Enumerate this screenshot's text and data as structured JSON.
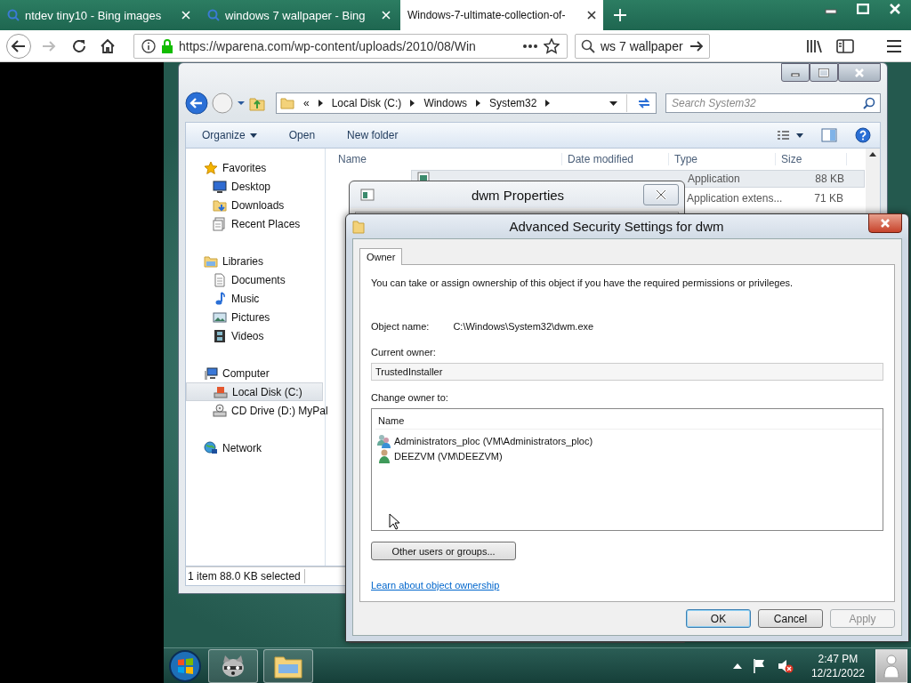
{
  "browser": {
    "tabs": [
      {
        "title": "ntdev tiny10 - Bing images",
        "selected": false
      },
      {
        "title": "windows 7 wallpaper - Bing",
        "selected": false
      },
      {
        "title": "Windows-7-ultimate-collection-of-",
        "selected": true
      }
    ],
    "url": "https://wparena.com/wp-content/uploads/2010/08/Win",
    "search": "ws 7 wallpaper"
  },
  "explorer": {
    "breadcrumb": [
      "«",
      "Local Disk (C:)",
      "Windows",
      "System32"
    ],
    "search_placeholder": "Search System32",
    "toolbar": [
      "Organize",
      "Open",
      "New folder"
    ],
    "nav": [
      {
        "label": "Favorites",
        "selected": false,
        "children": [
          {
            "label": "Desktop",
            "selected": false
          },
          {
            "label": "Downloads",
            "selected": false
          },
          {
            "label": "Recent Places",
            "selected": false
          }
        ]
      },
      {
        "label": "Libraries",
        "selected": false,
        "children": [
          {
            "label": "Documents",
            "selected": false
          },
          {
            "label": "Music",
            "selected": false
          },
          {
            "label": "Pictures",
            "selected": false
          },
          {
            "label": "Videos",
            "selected": false
          }
        ]
      },
      {
        "label": "Computer",
        "selected": false,
        "children": [
          {
            "label": "Local Disk (C:)",
            "selected": true
          },
          {
            "label": "CD Drive (D:) MyPal",
            "selected": false
          }
        ]
      },
      {
        "label": "Network",
        "selected": false
      }
    ],
    "columns": [
      "Name",
      "Date modified",
      "Type",
      "Size"
    ],
    "rows": [
      {
        "type": "Application",
        "size": "88 KB",
        "selected": true
      },
      {
        "type": "Application extens...",
        "size": "71 KB",
        "selected": false
      }
    ],
    "status": "1 item 88.0 KB selected"
  },
  "properties_window": {
    "title": "dwm Properties"
  },
  "dialog": {
    "title": "Advanced Security Settings for dwm",
    "tabs": [
      {
        "label": "Owner",
        "selected": true
      }
    ],
    "intro": "You can take or assign ownership of this object if you have the required permissions or privileges.",
    "object_name_label": "Object name:",
    "object_name": "C:\\Windows\\System32\\dwm.exe",
    "current_owner_label": "Current owner:",
    "current_owner": "TrustedInstaller",
    "change_owner_label": "Change owner to:",
    "owners_column": "Name",
    "owners": [
      {
        "name": "Administrators_ploc (VM\\Administrators_ploc)",
        "kind": "group"
      },
      {
        "name": "DEEZVM (VM\\DEEZVM)",
        "kind": "user"
      }
    ],
    "other_button": "Other users or groups...",
    "link": "Learn about object ownership",
    "buttons": [
      {
        "label": "OK",
        "disabled": false
      },
      {
        "label": "Cancel",
        "disabled": false
      },
      {
        "label": "Apply",
        "disabled": true
      }
    ]
  },
  "taskbar": {
    "time": "2:47 PM",
    "date": "12/21/2022"
  }
}
